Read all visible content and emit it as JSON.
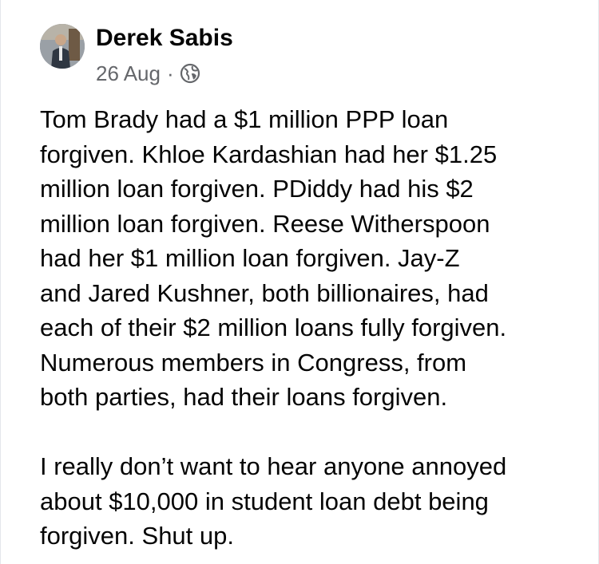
{
  "post": {
    "author": "Derek Sabis",
    "date": "26 Aug",
    "separator": "·",
    "privacy_icon": "globe-icon",
    "paragraph1_lines": [
      "Tom Brady had a $1 million PPP loan",
      "forgiven.  Khloe Kardashian had her $1.25",
      "million loan forgiven.  PDiddy had his $2",
      "million loan forgiven.  Reese Witherspoon",
      "had her $1 million loan forgiven.  Jay-Z",
      "and Jared Kushner, both billionaires, had",
      "each of their $2 million loans fully forgiven.",
      "Numerous members in Congress, from",
      "both parties, had their loans forgiven."
    ],
    "paragraph2_lines": [
      "I really don’t want to hear anyone annoyed",
      "about $10,000 in student loan debt being",
      "forgiven.  Shut up."
    ]
  },
  "colors": {
    "text": "#050505",
    "secondary_text": "#65676b",
    "background": "#ffffff"
  }
}
